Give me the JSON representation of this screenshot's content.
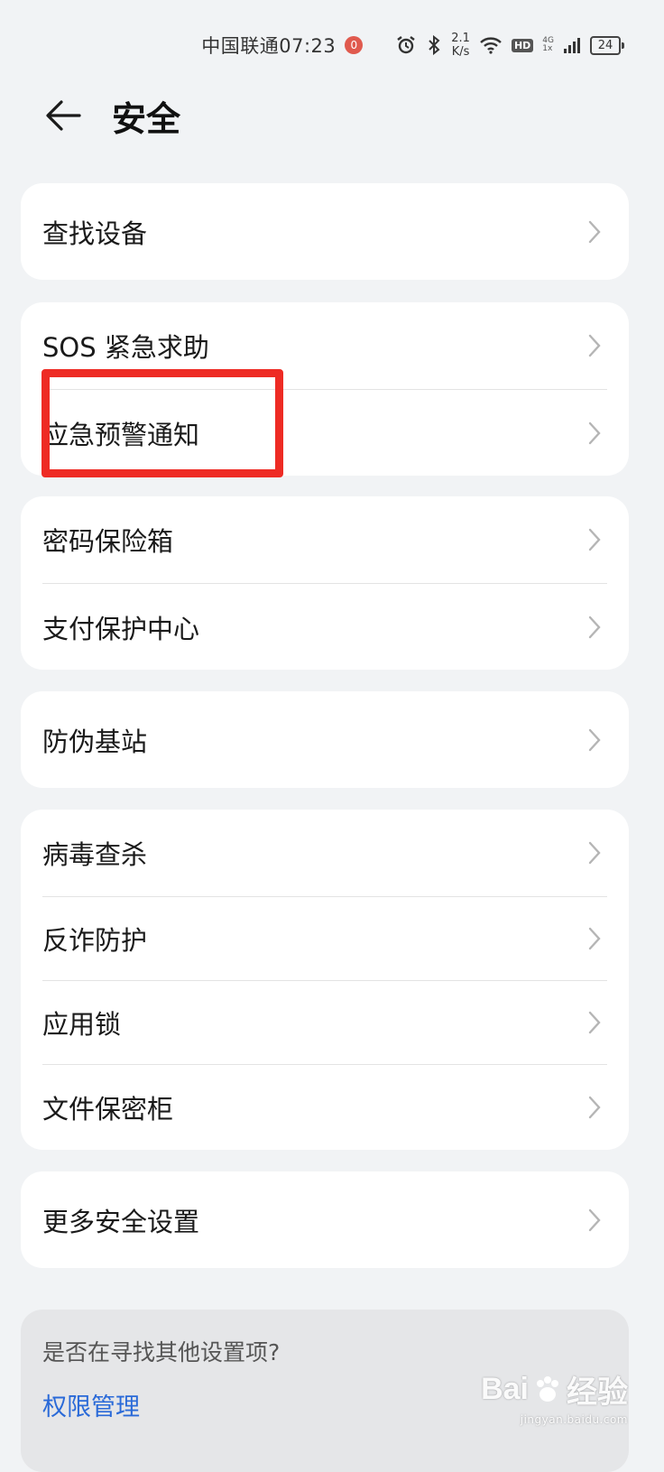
{
  "status_bar": {
    "carrier_time": "中国联通07:23",
    "notification_badge": "0",
    "net_speed_value": "2.1",
    "net_speed_unit": "K/s",
    "hd": "HD",
    "network_type": "4G",
    "network_sub": "1x",
    "battery": "24",
    "icons": [
      "alarm-icon",
      "bluetooth-icon",
      "wifi-icon",
      "signal-icon",
      "battery-icon"
    ]
  },
  "header": {
    "title": "安全",
    "back_icon": "arrow-left-icon"
  },
  "groups": [
    {
      "items": [
        {
          "label": "查找设备"
        }
      ]
    },
    {
      "items": [
        {
          "label": "SOS 紧急求助"
        },
        {
          "label": "应急预警通知"
        }
      ]
    },
    {
      "items": [
        {
          "label": "密码保险箱"
        },
        {
          "label": "支付保护中心"
        }
      ]
    },
    {
      "items": [
        {
          "label": "防伪基站"
        }
      ]
    },
    {
      "items": [
        {
          "label": "病毒查杀"
        },
        {
          "label": "反诈防护"
        },
        {
          "label": "应用锁"
        },
        {
          "label": "文件保密柜"
        }
      ]
    },
    {
      "items": [
        {
          "label": "更多安全设置"
        }
      ]
    }
  ],
  "suggestion": {
    "question": "是否在寻找其他设置项?",
    "link": "权限管理"
  },
  "watermark": {
    "main_left": "Bai",
    "main_right": "经验",
    "sub": "jingyan.baidu.com"
  },
  "colors": {
    "background": "#f1f3f5",
    "card": "#ffffff",
    "link": "#2a6ad8",
    "highlight": "#ee2b24"
  }
}
